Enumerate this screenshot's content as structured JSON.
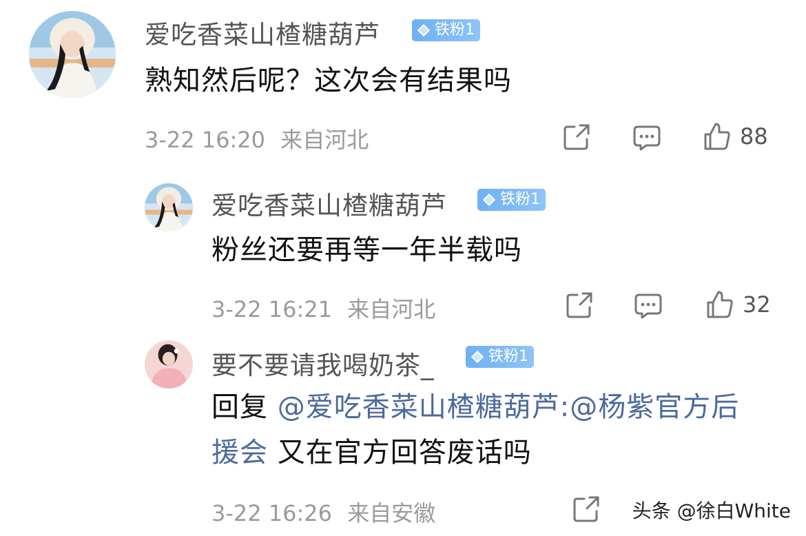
{
  "comments": [
    {
      "username": "爱吃香菜山楂糖葫芦",
      "badge": "铁粉1",
      "text": "熟知然后呢？这次会有结果吗",
      "timestamp": "3-22 16:20",
      "location": "来自河北",
      "likes": "88",
      "avatar_icon": "avatar-girl-white-hood"
    },
    {
      "username": "爱吃香菜山楂糖葫芦",
      "badge": "铁粉1",
      "text": "粉丝还要再等一年半载吗",
      "timestamp": "3-22 16:21",
      "location": "来自河北",
      "likes": "32",
      "avatar_icon": "avatar-girl-white-hood"
    },
    {
      "username": "要不要请我喝奶茶_",
      "badge": "铁粉1",
      "text_prefix": "回复 ",
      "mention": "@爱吃香菜山楂糖葫芦:@杨紫官方后援会",
      "text_suffix": " 又在官方回答废话吗",
      "timestamp": "3-22 16:26",
      "location": "来自安徽",
      "avatar_icon": "avatar-girl-pink"
    }
  ],
  "watermark": "头条 @徐白White",
  "colors": {
    "badge": "#7db8f5",
    "mention": "#4c6a9c",
    "meta": "#9a9a9a"
  }
}
